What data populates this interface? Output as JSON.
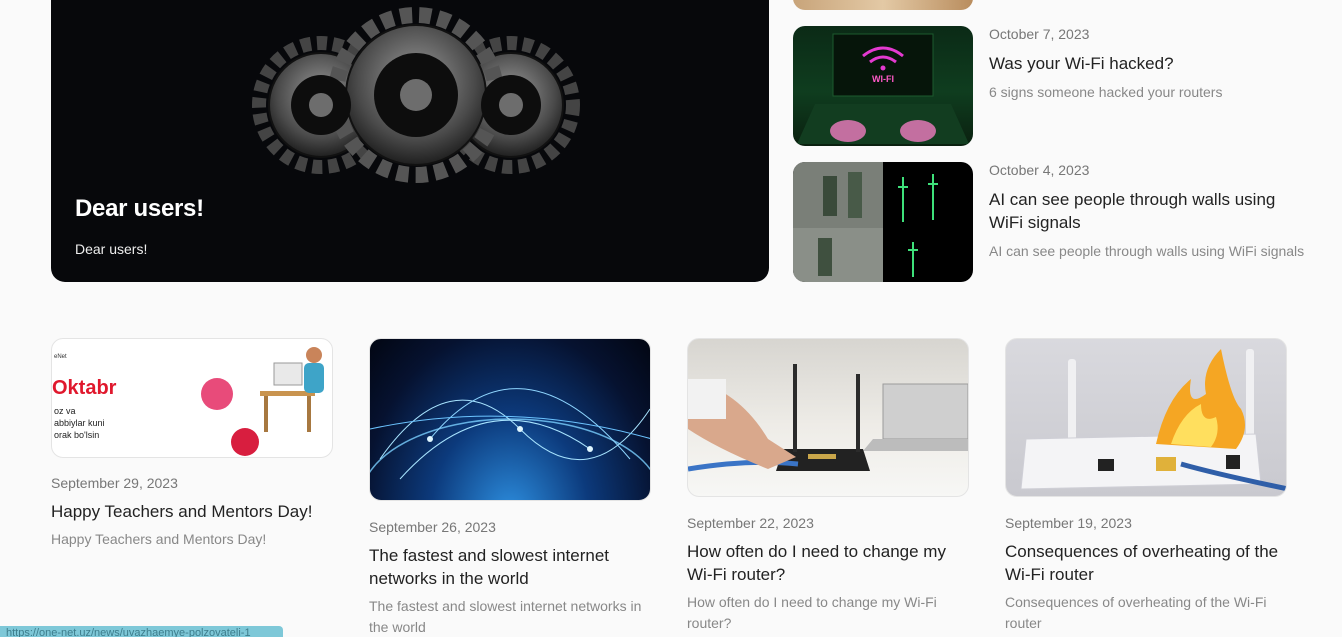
{
  "hero": {
    "title": "Dear users!",
    "subtitle": "Dear users!"
  },
  "side_items": [
    {
      "date": "October 7, 2023",
      "title": "Was your Wi-Fi hacked?",
      "desc": "6 signs someone hacked your routers",
      "thumb_text": "WI-FI"
    },
    {
      "date": "October 4, 2023",
      "title": "AI can see people through walls using WiFi signals",
      "desc": "AI can see people through walls using WiFi signals"
    }
  ],
  "cards": [
    {
      "date": "September 29, 2023",
      "title": "Happy Teachers and Mentors Day!",
      "desc": "Happy Teachers and Mentors Day!",
      "img_text": {
        "brand": "eNet",
        "month": "Oktabr",
        "line1": "oz va",
        "line2": "abbiylar kuni",
        "line3": "orak bo'lsin"
      }
    },
    {
      "date": "September 26, 2023",
      "title": "The fastest and slowest internet networks in the world",
      "desc": "The fastest and slowest internet networks in the world"
    },
    {
      "date": "September 22, 2023",
      "title": "How often do I need to change my Wi-Fi router?",
      "desc": "How often do I need to change my Wi-Fi router?"
    },
    {
      "date": "September 19, 2023",
      "title": "Consequences of overheating of the Wi-Fi router",
      "desc": "Consequences of overheating of the Wi-Fi router"
    }
  ],
  "status_url": "https://one-net.uz/news/uvazhaemye-polzovateli-1"
}
